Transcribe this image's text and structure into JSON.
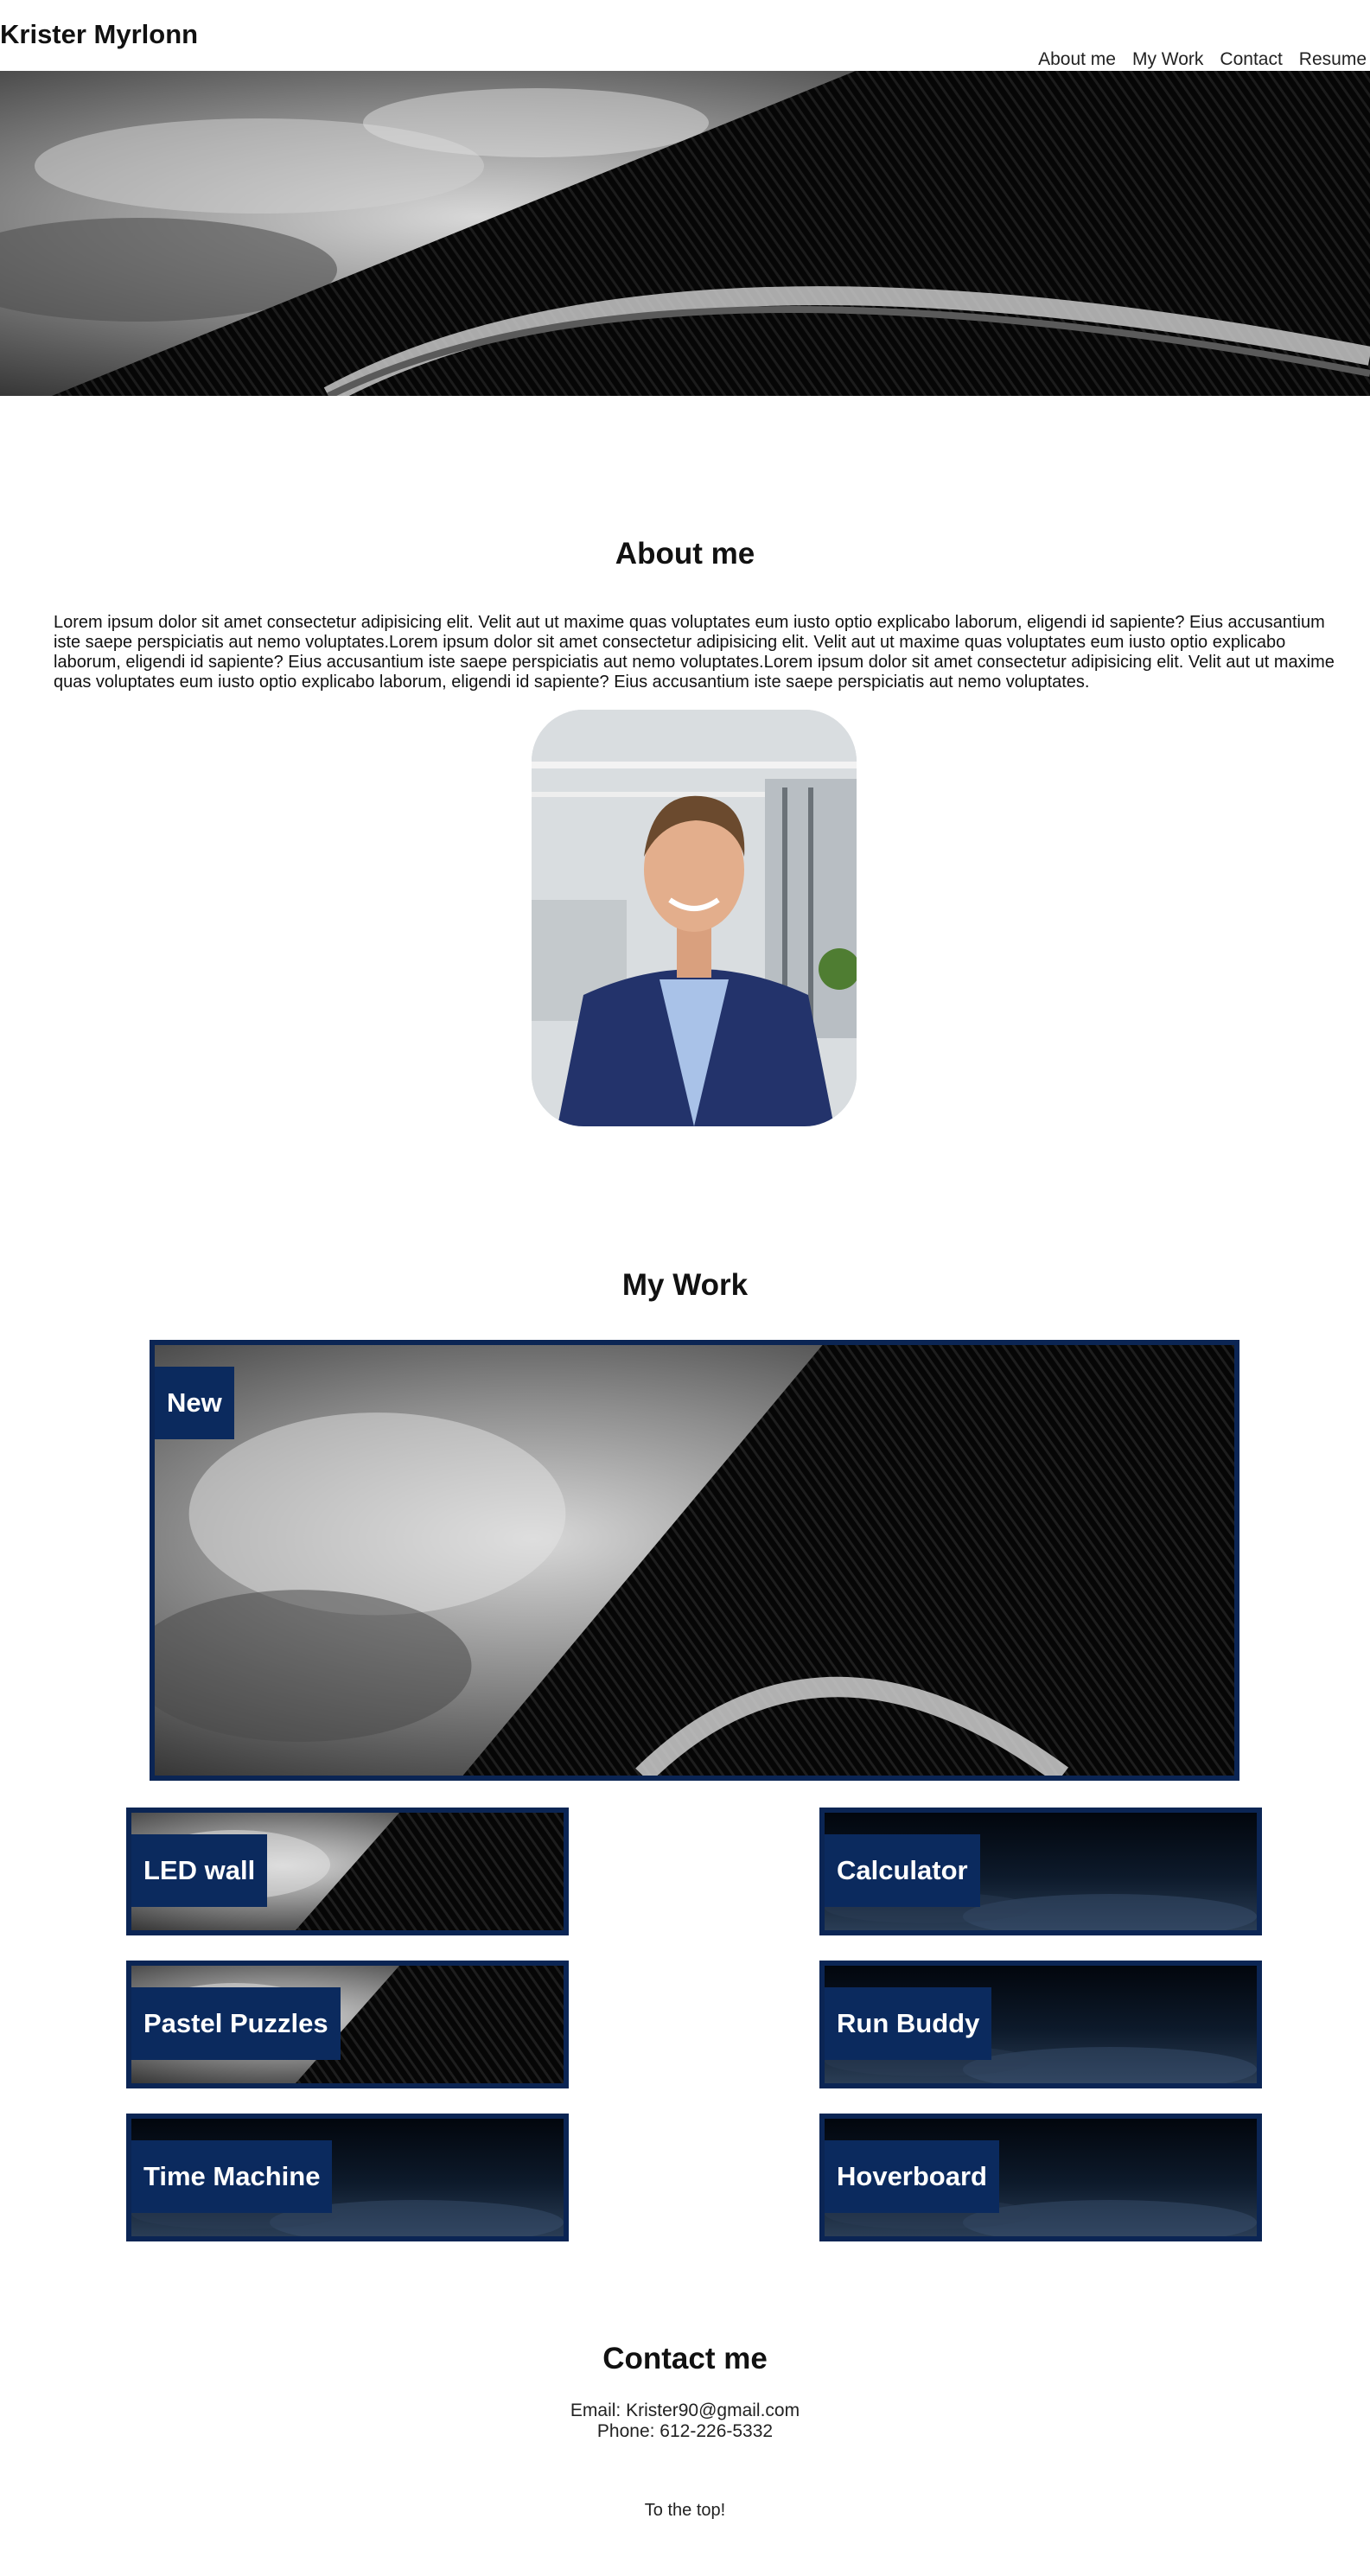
{
  "header": {
    "site_title": "Krister Myrlonn",
    "nav": [
      "About me",
      "My Work",
      "Contact",
      "Resume"
    ]
  },
  "about": {
    "heading": "About me",
    "text": "Lorem ipsum dolor sit amet consectetur adipisicing elit. Velit aut ut maxime quas voluptates eum iusto optio explicabo laborum, eligendi id sapiente? Eius accusantium iste saepe perspiciatis aut nemo voluptates.Lorem ipsum dolor sit amet consectetur adipisicing elit. Velit aut ut maxime quas voluptates eum iusto optio explicabo laborum, eligendi id sapiente? Eius accusantium iste saepe perspiciatis aut nemo voluptates.Lorem ipsum dolor sit amet consectetur adipisicing elit. Velit aut ut maxime quas voluptates eum iusto optio explicabo laborum, eligendi id sapiente? Eius accusantium iste saepe perspiciatis aut nemo voluptates."
  },
  "work": {
    "heading": "My Work",
    "featured_label": "New",
    "projects": [
      "LED wall",
      "Calculator",
      "Pastel Puzzles",
      "Run Buddy",
      "Time Machine",
      "Hoverboard"
    ]
  },
  "contact": {
    "heading": "Contact me",
    "email": "Email: Krister90@gmail.com",
    "phone": "Phone: 612-226-5332"
  },
  "footer": {
    "to_top": "To the top!"
  },
  "colors": {
    "card_border": "#0b2554",
    "label_bg": "#0b2a5e"
  }
}
